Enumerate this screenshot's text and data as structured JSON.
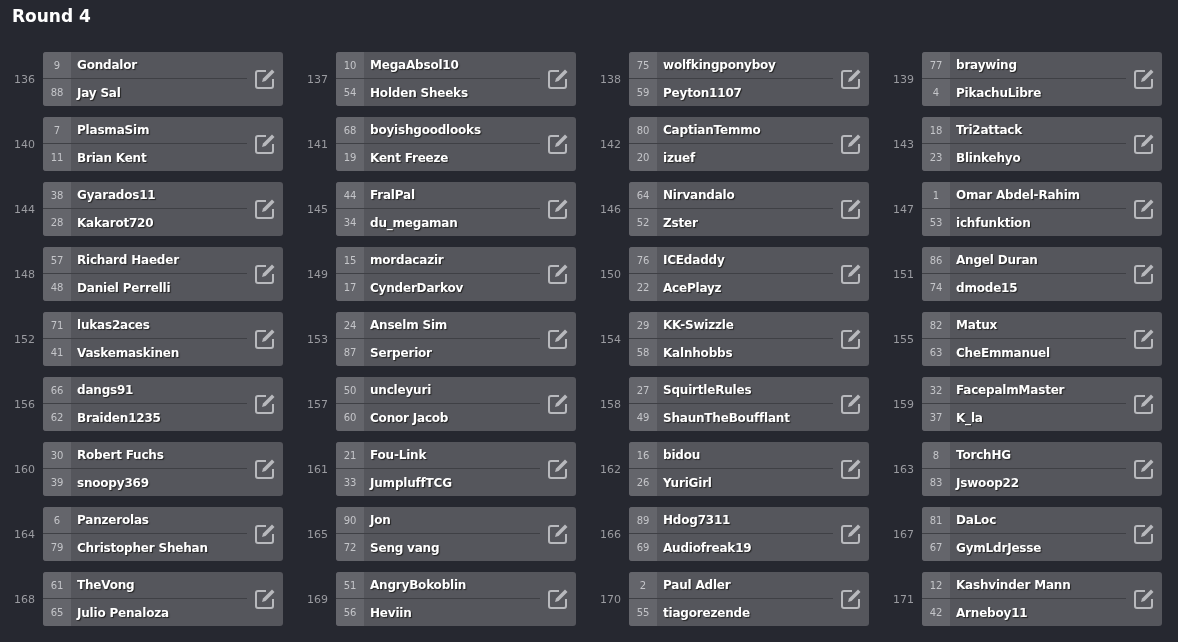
{
  "title": "Round 4",
  "matches": [
    {
      "number": "136",
      "players": [
        {
          "seed": "9",
          "name": "Gondalor"
        },
        {
          "seed": "88",
          "name": "Jay Sal"
        }
      ]
    },
    {
      "number": "137",
      "players": [
        {
          "seed": "10",
          "name": "MegaAbsol10"
        },
        {
          "seed": "54",
          "name": "Holden Sheeks"
        }
      ]
    },
    {
      "number": "138",
      "players": [
        {
          "seed": "75",
          "name": "wolfkingponyboy"
        },
        {
          "seed": "59",
          "name": "Peyton1107"
        }
      ]
    },
    {
      "number": "139",
      "players": [
        {
          "seed": "77",
          "name": "braywing"
        },
        {
          "seed": "4",
          "name": "PikachuLibre"
        }
      ]
    },
    {
      "number": "140",
      "players": [
        {
          "seed": "7",
          "name": "PlasmaSim"
        },
        {
          "seed": "11",
          "name": "Brian Kent"
        }
      ]
    },
    {
      "number": "141",
      "players": [
        {
          "seed": "68",
          "name": "boyishgoodlooks"
        },
        {
          "seed": "19",
          "name": "Kent Freeze"
        }
      ]
    },
    {
      "number": "142",
      "players": [
        {
          "seed": "80",
          "name": "CaptianTemmo"
        },
        {
          "seed": "20",
          "name": "izuef"
        }
      ]
    },
    {
      "number": "143",
      "players": [
        {
          "seed": "18",
          "name": "Tri2attack"
        },
        {
          "seed": "23",
          "name": "Blinkehyo"
        }
      ]
    },
    {
      "number": "144",
      "players": [
        {
          "seed": "38",
          "name": "Gyarados11"
        },
        {
          "seed": "28",
          "name": "Kakarot720"
        }
      ]
    },
    {
      "number": "145",
      "players": [
        {
          "seed": "44",
          "name": "FralPal"
        },
        {
          "seed": "34",
          "name": "du_megaman"
        }
      ]
    },
    {
      "number": "146",
      "players": [
        {
          "seed": "64",
          "name": "Nirvandalo"
        },
        {
          "seed": "52",
          "name": "Zster"
        }
      ]
    },
    {
      "number": "147",
      "players": [
        {
          "seed": "1",
          "name": "Omar Abdel-Rahim"
        },
        {
          "seed": "53",
          "name": "ichfunktion"
        }
      ]
    },
    {
      "number": "148",
      "players": [
        {
          "seed": "57",
          "name": "Richard Haeder"
        },
        {
          "seed": "48",
          "name": "Daniel Perrelli"
        }
      ]
    },
    {
      "number": "149",
      "players": [
        {
          "seed": "15",
          "name": "mordacazir"
        },
        {
          "seed": "17",
          "name": "CynderDarkov"
        }
      ]
    },
    {
      "number": "150",
      "players": [
        {
          "seed": "76",
          "name": "ICEdaddy"
        },
        {
          "seed": "22",
          "name": "AcePlayz"
        }
      ]
    },
    {
      "number": "151",
      "players": [
        {
          "seed": "86",
          "name": "Angel Duran"
        },
        {
          "seed": "74",
          "name": "dmode15"
        }
      ]
    },
    {
      "number": "152",
      "players": [
        {
          "seed": "71",
          "name": "lukas2aces"
        },
        {
          "seed": "41",
          "name": "Vaskemaskinen"
        }
      ]
    },
    {
      "number": "153",
      "players": [
        {
          "seed": "24",
          "name": "Anselm Sim"
        },
        {
          "seed": "87",
          "name": "Serperior"
        }
      ]
    },
    {
      "number": "154",
      "players": [
        {
          "seed": "29",
          "name": "KK-Swizzle"
        },
        {
          "seed": "58",
          "name": "Kalnhobbs"
        }
      ]
    },
    {
      "number": "155",
      "players": [
        {
          "seed": "82",
          "name": "Matux"
        },
        {
          "seed": "63",
          "name": "CheEmmanuel"
        }
      ]
    },
    {
      "number": "156",
      "players": [
        {
          "seed": "66",
          "name": "dangs91"
        },
        {
          "seed": "62",
          "name": "Braiden1235"
        }
      ]
    },
    {
      "number": "157",
      "players": [
        {
          "seed": "50",
          "name": "uncleyuri"
        },
        {
          "seed": "60",
          "name": "Conor Jacob"
        }
      ]
    },
    {
      "number": "158",
      "players": [
        {
          "seed": "27",
          "name": "SquirtleRules"
        },
        {
          "seed": "49",
          "name": "ShaunTheBoufflant"
        }
      ]
    },
    {
      "number": "159",
      "players": [
        {
          "seed": "32",
          "name": "FacepalmMaster"
        },
        {
          "seed": "37",
          "name": "K_la"
        }
      ]
    },
    {
      "number": "160",
      "players": [
        {
          "seed": "30",
          "name": "Robert Fuchs"
        },
        {
          "seed": "39",
          "name": "snoopy369"
        }
      ]
    },
    {
      "number": "161",
      "players": [
        {
          "seed": "21",
          "name": "Fou-Link"
        },
        {
          "seed": "33",
          "name": "JumpluffTCG"
        }
      ]
    },
    {
      "number": "162",
      "players": [
        {
          "seed": "16",
          "name": "bidou"
        },
        {
          "seed": "26",
          "name": "YuriGirl"
        }
      ]
    },
    {
      "number": "163",
      "players": [
        {
          "seed": "8",
          "name": "TorchHG"
        },
        {
          "seed": "83",
          "name": "Jswoop22"
        }
      ]
    },
    {
      "number": "164",
      "players": [
        {
          "seed": "6",
          "name": "Panzerolas"
        },
        {
          "seed": "79",
          "name": "Christopher Shehan"
        }
      ]
    },
    {
      "number": "165",
      "players": [
        {
          "seed": "90",
          "name": "Jon"
        },
        {
          "seed": "72",
          "name": "Seng vang"
        }
      ]
    },
    {
      "number": "166",
      "players": [
        {
          "seed": "89",
          "name": "Hdog7311"
        },
        {
          "seed": "69",
          "name": "Audiofreak19"
        }
      ]
    },
    {
      "number": "167",
      "players": [
        {
          "seed": "81",
          "name": "DaLoc"
        },
        {
          "seed": "67",
          "name": "GymLdrJesse"
        }
      ]
    },
    {
      "number": "168",
      "players": [
        {
          "seed": "61",
          "name": "TheVong"
        },
        {
          "seed": "65",
          "name": "Julio Penaloza"
        }
      ]
    },
    {
      "number": "169",
      "players": [
        {
          "seed": "51",
          "name": "AngryBokoblin"
        },
        {
          "seed": "56",
          "name": "Heviin"
        }
      ]
    },
    {
      "number": "170",
      "players": [
        {
          "seed": "2",
          "name": "Paul Adler"
        },
        {
          "seed": "55",
          "name": "tiagorezende"
        }
      ]
    },
    {
      "number": "171",
      "players": [
        {
          "seed": "12",
          "name": "Kashvinder Mann"
        },
        {
          "seed": "42",
          "name": "Arneboy11"
        }
      ]
    }
  ]
}
